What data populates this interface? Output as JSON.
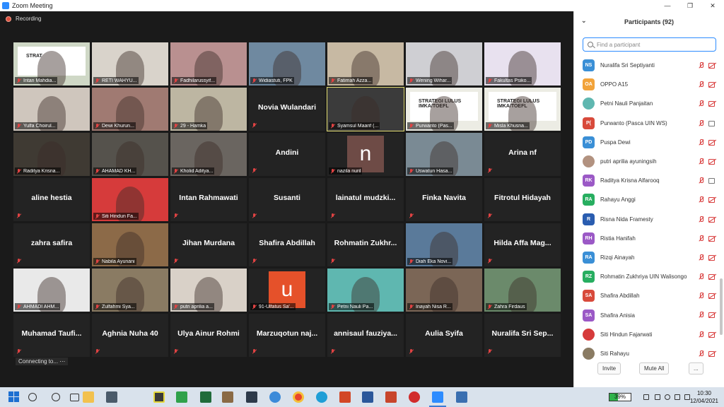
{
  "window": {
    "title": "Zoom Meeting",
    "controls": [
      "—",
      "❐",
      "✕"
    ]
  },
  "meeting": {
    "recording_label": "Recording",
    "connecting_label": "Connecting to... ⋯",
    "grid": [
      [
        {
          "name": "Intan Mahdia...",
          "kind": "video",
          "bg": "#cfd8c6",
          "slide": "STRAT"
        },
        {
          "name": "RETI WAHYU...",
          "kind": "video",
          "bg": "#d9d3cb"
        },
        {
          "name": "Fadhilarussyif...",
          "kind": "video",
          "bg": "#b99090"
        },
        {
          "name": "Widiastuti, FPK",
          "kind": "video",
          "bg": "#6f89a0"
        },
        {
          "name": "Fatimah Azza...",
          "kind": "video",
          "bg": "#c7b9a3"
        },
        {
          "name": "Wening Wihar...",
          "kind": "video",
          "bg": "#cfcfd3"
        },
        {
          "name": "Fakultas Psiko...",
          "kind": "video",
          "bg": "#e8e1ef"
        }
      ],
      [
        {
          "name": "Yulfa Choirul...",
          "kind": "video",
          "bg": "#cfc6bd"
        },
        {
          "name": "Dewi Khurun...",
          "kind": "video",
          "bg": "#a07a72"
        },
        {
          "name": "29 - Hamka",
          "kind": "video",
          "bg": "#bdb6a2"
        },
        {
          "name": "Novia Wulandari",
          "kind": "name"
        },
        {
          "name": "Syamsul Maarif (...",
          "kind": "video",
          "bg": "#3b3b3b",
          "active": true
        },
        {
          "name": "Purwanto (Pas...",
          "kind": "video",
          "bg": "#ecece4",
          "slide": "STRATEGI LULUS IMKA/TOEFL"
        },
        {
          "name": "Misla Khusna...",
          "kind": "video",
          "bg": "#ecece4",
          "slide": "STRATEGI LULUS IMKA/TOEFL"
        }
      ],
      [
        {
          "name": "Raditya Krisna...",
          "kind": "video",
          "bg": "#3f3a33"
        },
        {
          "name": "AHAMAD KH...",
          "kind": "video",
          "bg": "#55524c"
        },
        {
          "name": "Kholid Aditya...",
          "kind": "video",
          "bg": "#6a6560"
        },
        {
          "name": "Andini",
          "kind": "name"
        },
        {
          "name": "nazila nuril",
          "kind": "letter",
          "letter": "n",
          "letter_bg": "#6e4b46"
        },
        {
          "name": "Uswatun Hasa...",
          "kind": "video",
          "bg": "#7a8a94"
        },
        {
          "name": "Arina nf",
          "kind": "name"
        }
      ],
      [
        {
          "name": "aline hestia",
          "kind": "name"
        },
        {
          "name": "Siti Hindun Fa...",
          "kind": "video",
          "bg": "#d63b3b"
        },
        {
          "name": "Intan Rahmawati",
          "kind": "name"
        },
        {
          "name": "Susanti",
          "kind": "name"
        },
        {
          "name": "lainatul mudzki...",
          "kind": "name"
        },
        {
          "name": "Finka Navita",
          "kind": "name"
        },
        {
          "name": "Fitrotul Hidayah",
          "kind": "name"
        }
      ],
      [
        {
          "name": "zahra safira",
          "kind": "name"
        },
        {
          "name": "Nabila Ayunani",
          "kind": "video",
          "bg": "#8c6a48"
        },
        {
          "name": "Jihan Murdana",
          "kind": "name"
        },
        {
          "name": "Shafira Abdillah",
          "kind": "name"
        },
        {
          "name": "Rohmatin Zukhr...",
          "kind": "name"
        },
        {
          "name": "Diah Eka Novi...",
          "kind": "video",
          "bg": "#5a7a9a"
        },
        {
          "name": "Hilda Affa Mag...",
          "kind": "name"
        }
      ],
      [
        {
          "name": "AHMADI AHM...",
          "kind": "video",
          "bg": "#e9e9e9"
        },
        {
          "name": "Zulfahmi Sya...",
          "kind": "video",
          "bg": "#8a7b63"
        },
        {
          "name": "putri aprilia a...",
          "kind": "video",
          "bg": "#d9d1c8"
        },
        {
          "name": "91-Ulfatus Sa'...",
          "kind": "letter",
          "letter": "u",
          "letter_bg": "#e5512a"
        },
        {
          "name": "Petni Nauli Pa...",
          "kind": "video",
          "bg": "#5fb7b0"
        },
        {
          "name": "Inayah Nisa R...",
          "kind": "video",
          "bg": "#7b6656"
        },
        {
          "name": "Zahra Firdaus",
          "kind": "video",
          "bg": "#6b8a6b"
        }
      ],
      [
        {
          "name": "Muhamad Taufi...",
          "kind": "name"
        },
        {
          "name": "Aghnia Nuha 40",
          "kind": "name"
        },
        {
          "name": "Ulya Ainur Rohmi",
          "kind": "name"
        },
        {
          "name": "Marzuqotun naj...",
          "kind": "name"
        },
        {
          "name": "annisaul fauziya...",
          "kind": "name"
        },
        {
          "name": "Aulia Syifa",
          "kind": "name"
        },
        {
          "name": "Nuralifa Sri Sep...",
          "kind": "name"
        }
      ]
    ]
  },
  "participants": {
    "title": "Participants (92)",
    "search_placeholder": "Find a participant",
    "list": [
      {
        "initials": "NS",
        "name": "Nuralifa Sri Septiyanti",
        "color": "#3a8fd6",
        "cam": "off"
      },
      {
        "initials": "OA",
        "name": "OPPO A15",
        "color": "#f2a33a",
        "cam": "off"
      },
      {
        "initials": "",
        "name": "Petni Nauli Panjaitan",
        "color": "#5fb7b0",
        "photo": true,
        "cam": "off"
      },
      {
        "initials": "P(",
        "name": "Purwanto (Pasca UIN WS)",
        "color": "#d84a3b",
        "cam": "on"
      },
      {
        "initials": "PD",
        "name": "Puspa Dewi",
        "color": "#3a8fd6",
        "cam": "off"
      },
      {
        "initials": "",
        "name": "putri aprilia ayuningsih",
        "color": "#b29280",
        "photo": true,
        "cam": "off"
      },
      {
        "initials": "RK",
        "name": "Raditya Krisna Alfarooq",
        "color": "#9b59c6",
        "cam": "on"
      },
      {
        "initials": "RA",
        "name": "Rahayu Anggi",
        "color": "#27ae60",
        "cam": "off"
      },
      {
        "initials": "R",
        "name": "Risna Nida Framesty",
        "color": "#2a5db0",
        "cam": "off"
      },
      {
        "initials": "RH",
        "name": "Ristia Hanifah",
        "color": "#9b59c6",
        "cam": "off"
      },
      {
        "initials": "RA",
        "name": "Rizqi Ainayah",
        "color": "#3a8fd6",
        "cam": "off"
      },
      {
        "initials": "RZ",
        "name": "Rohmatin Zukhriya UIN Walisongo",
        "color": "#27ae60",
        "cam": "off"
      },
      {
        "initials": "SA",
        "name": "Shafira Abdillah",
        "color": "#d84a3b",
        "cam": "off"
      },
      {
        "initials": "SA",
        "name": "Shafira Anisia",
        "color": "#9b59c6",
        "cam": "off"
      },
      {
        "initials": "",
        "name": "Siti Hindun Fajarwati",
        "color": "#d63b3b",
        "photo": true,
        "cam": "off"
      },
      {
        "initials": "",
        "name": "Siti Rahayu",
        "color": "#8a7b63",
        "photo": true,
        "cam": "off"
      }
    ],
    "invite_label": "Invite",
    "mute_all_label": "Mute All",
    "more_label": "..."
  },
  "taskbar": {
    "battery": "39%",
    "time": "10:30",
    "date": "12/04/2021"
  }
}
